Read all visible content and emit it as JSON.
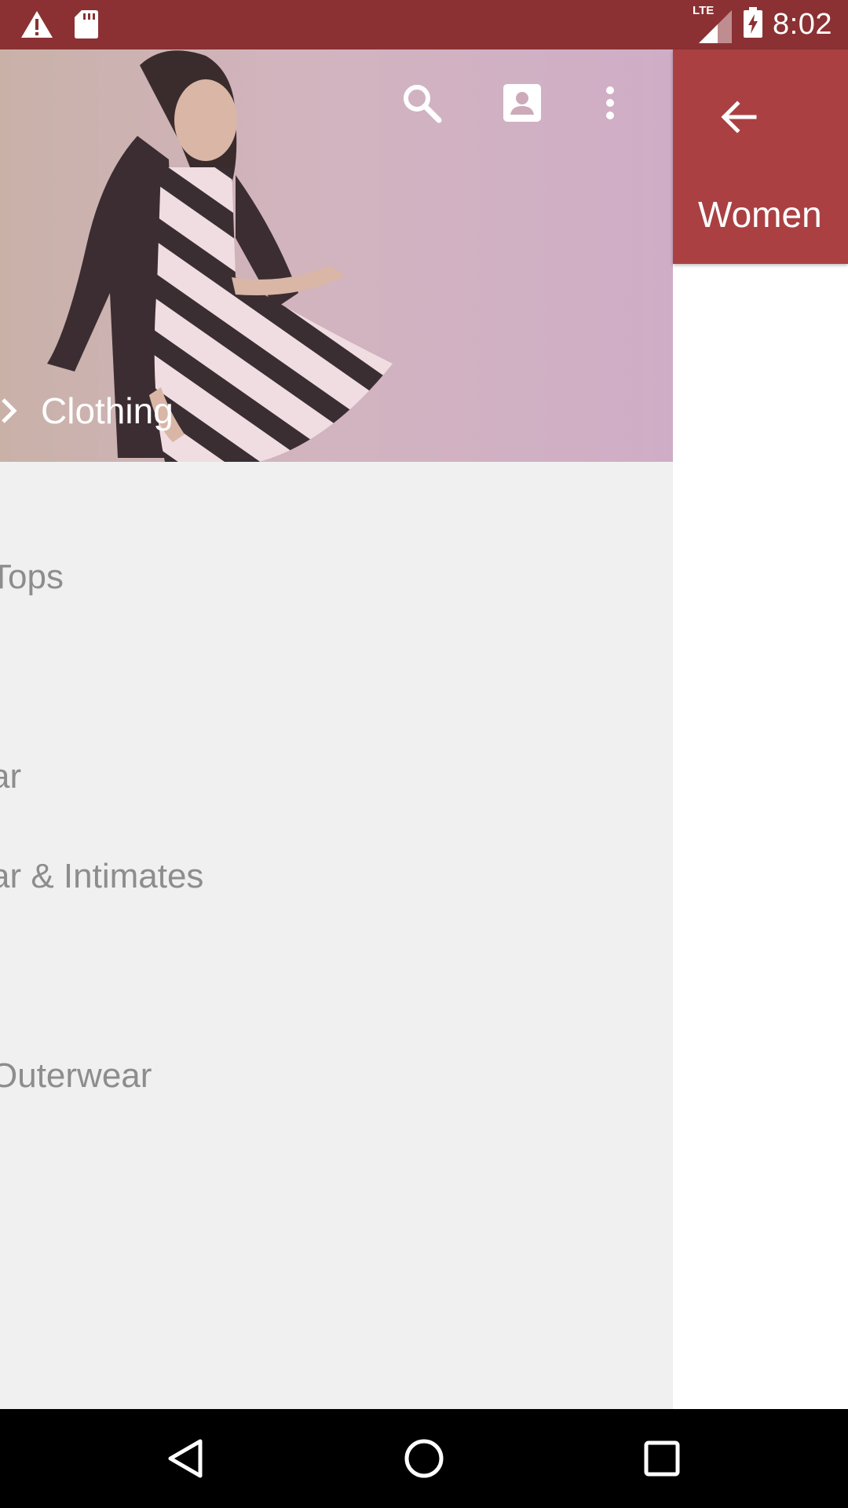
{
  "status_bar": {
    "time": "8:02",
    "network": "LTE",
    "icons": [
      "warning-icon",
      "sd-card-icon",
      "signal-icon",
      "battery-charging-icon"
    ]
  },
  "drawer": {
    "header_icons": [
      "search-icon",
      "account-icon",
      "more-vert-icon"
    ],
    "section": {
      "label": "Clothing",
      "icon": "chevron-right-icon"
    },
    "categories": [
      "Tops",
      "ar",
      "ar & Intimates",
      "Outerwear"
    ]
  },
  "panel": {
    "back_icon": "arrow-back-icon",
    "title": "Women"
  },
  "nav_bar": {
    "icons": [
      "back-triangle-icon",
      "home-circle-icon",
      "recents-square-icon"
    ]
  },
  "colors": {
    "status_bar": "#8b3133",
    "panel_header": "#aa4042",
    "list_text": "#8d8d8d",
    "list_bg": "#f0f0f1"
  }
}
